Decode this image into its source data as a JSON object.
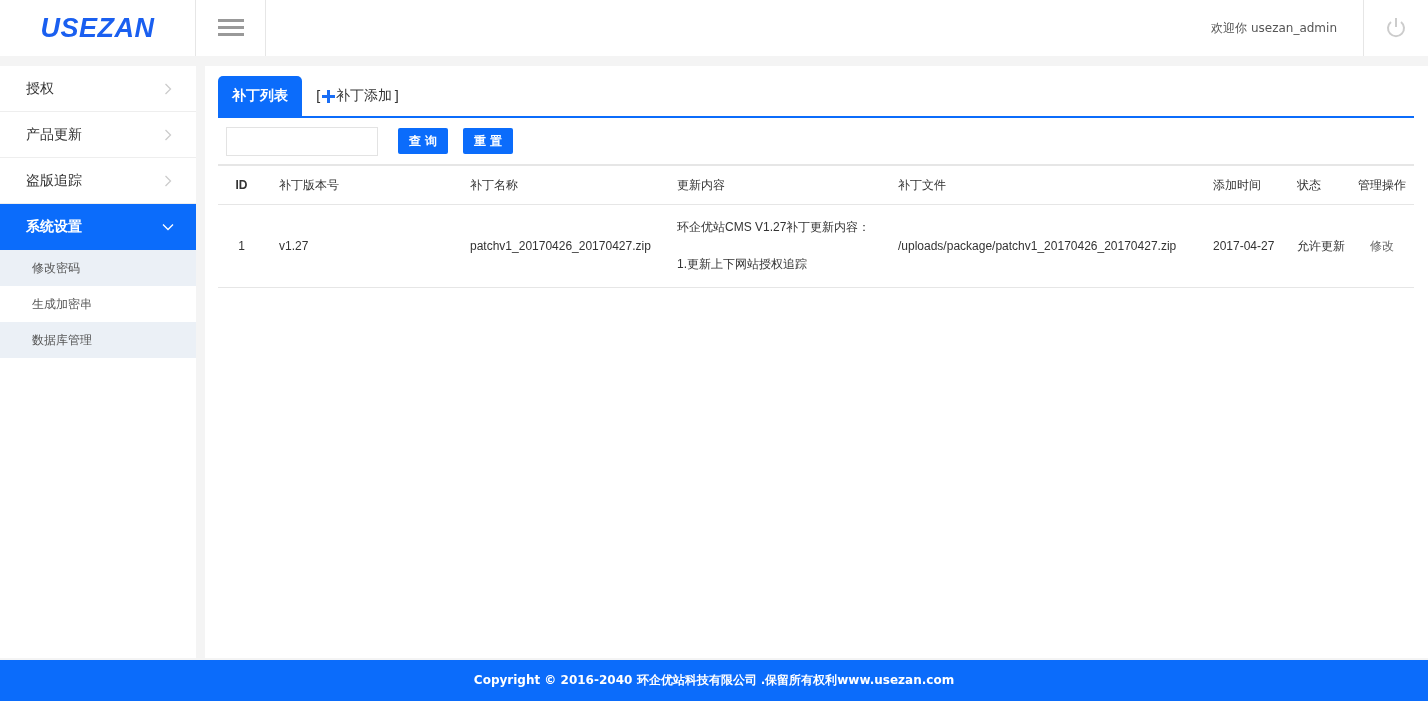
{
  "header": {
    "logo": "USEZAN",
    "welcome": "欢迎你 usezan_admin"
  },
  "sidebar": {
    "items": [
      {
        "label": "授权",
        "selected": false,
        "expanded": false
      },
      {
        "label": "产品更新",
        "selected": false,
        "expanded": false
      },
      {
        "label": "盗版追踪",
        "selected": false,
        "expanded": false
      },
      {
        "label": "系统设置",
        "selected": true,
        "expanded": true,
        "children": [
          {
            "label": "修改密码"
          },
          {
            "label": "生成加密串"
          },
          {
            "label": "数据库管理"
          }
        ]
      }
    ]
  },
  "tabs": [
    {
      "label": "补丁列表",
      "selected": true,
      "kind": "plain"
    },
    {
      "label": "补丁添加",
      "selected": false,
      "kind": "add",
      "open_bracket": "[",
      "close_bracket": "]"
    }
  ],
  "search": {
    "query_button": "查 询",
    "reset_button": "重 置"
  },
  "table": {
    "columns": [
      "ID",
      "补丁版本号",
      "补丁名称",
      "更新内容",
      "补丁文件",
      "添加时间",
      "状态",
      "管理操作"
    ],
    "rows": [
      {
        "id": "1",
        "version": "v1.27",
        "name": "patchv1_20170426_20170427.zip",
        "content": [
          "环企优站CMS V1.27补丁更新内容：",
          "1.更新上下网站授权追踪"
        ],
        "file": "/uploads/package/patchv1_20170426_20170427.zip",
        "time": "2017-04-27",
        "status": "允许更新",
        "action": "修改"
      }
    ]
  },
  "footer": "Copyright © 2016-2040 环企优站科技有限公司 .保留所有权利www.usezan.com"
}
